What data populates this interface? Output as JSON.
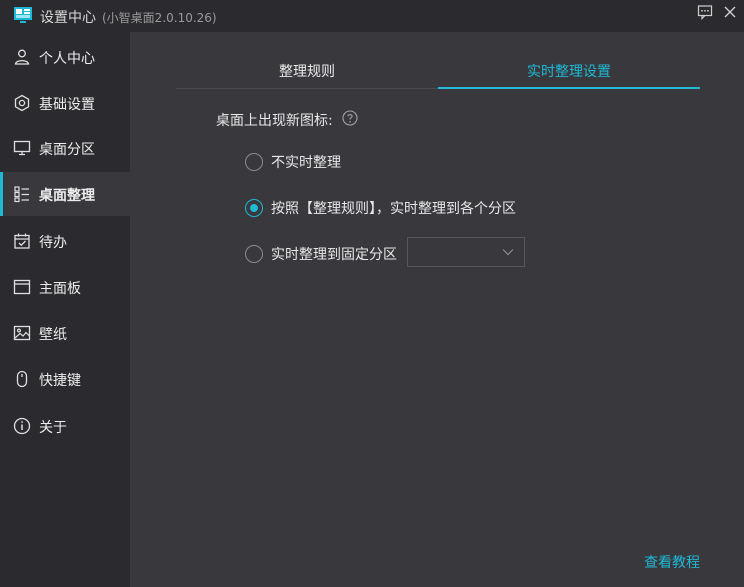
{
  "window": {
    "title": "设置中心",
    "subtitle": "(小智桌面2.0.10.26)",
    "logo_icon": "app-logo-icon",
    "feedback_icon": "feedback-icon",
    "close_icon": "close-icon"
  },
  "sidebar": {
    "items": [
      {
        "label": "个人中心",
        "icon": "user-icon",
        "active": false
      },
      {
        "label": "基础设置",
        "icon": "settings-icon",
        "active": false
      },
      {
        "label": "桌面分区",
        "icon": "monitor-icon",
        "active": false
      },
      {
        "label": "桌面整理",
        "icon": "organize-icon",
        "active": true
      },
      {
        "label": "待办",
        "icon": "calendar-check-icon",
        "active": false
      },
      {
        "label": "主面板",
        "icon": "panel-icon",
        "active": false
      },
      {
        "label": "壁纸",
        "icon": "image-icon",
        "active": false
      },
      {
        "label": "快捷键",
        "icon": "mouse-icon",
        "active": false
      },
      {
        "label": "关于",
        "icon": "info-icon",
        "active": false
      }
    ]
  },
  "tabs": [
    {
      "label": "整理规则",
      "active": false
    },
    {
      "label": "实时整理设置",
      "active": true
    }
  ],
  "settings": {
    "section_label": "桌面上出现新图标:",
    "options": [
      {
        "label": "不实时整理",
        "checked": false
      },
      {
        "label": "按照【整理规则】，实时整理到各个分区",
        "checked": true
      },
      {
        "label": "实时整理到固定分区",
        "checked": false
      }
    ],
    "partition_select_value": ""
  },
  "footer": {
    "tutorial_link": "查看教程"
  },
  "colors": {
    "accent": "#1fb8d6",
    "sidebar_bg": "#2b2b2f",
    "content_bg": "#38383d"
  }
}
